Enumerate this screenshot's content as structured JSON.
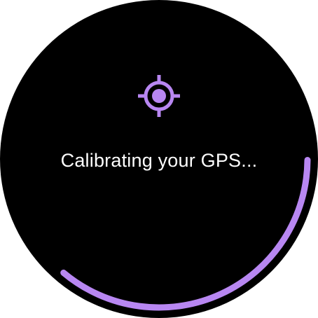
{
  "screen": {
    "status_text": "Calibrating your GPS...",
    "icon": "gps-crosshair-icon"
  },
  "progress": {
    "fraction": 0.36
  },
  "colors": {
    "background": "#000000",
    "accent": "#B887F2",
    "text": "#FFFFFF"
  }
}
